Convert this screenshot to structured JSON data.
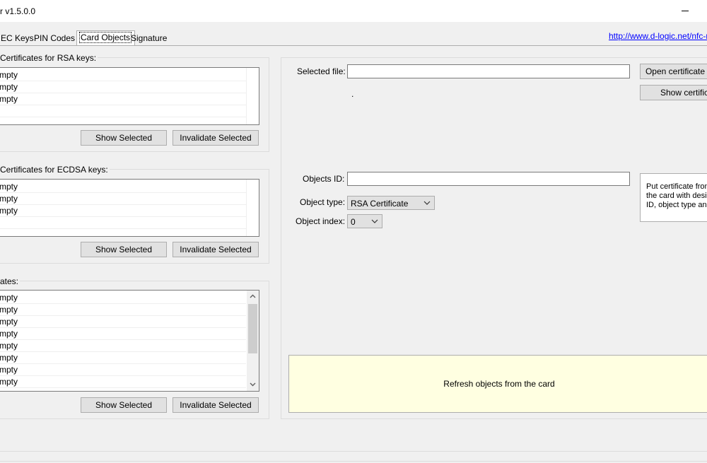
{
  "window": {
    "title": "r v1.5.0.0",
    "minimize_glyph": "minimize-icon"
  },
  "tabs": [
    {
      "label": "EC Keys"
    },
    {
      "label": "PIN Codes"
    },
    {
      "label": "Card Objects",
      "active": true
    },
    {
      "label": "Signature"
    }
  ],
  "link": "http://www.d-logic.net/nfc-rfi",
  "rsa_group": {
    "title": "Certificates for RSA keys:",
    "items": [
      "mpty",
      "mpty",
      "mpty"
    ],
    "show_label": "Show Selected",
    "invalidate_label": "Invalidate Selected"
  },
  "ecdsa_group": {
    "title": "Certificates for ECDSA keys:",
    "items": [
      "mpty",
      "mpty",
      "mpty"
    ],
    "show_label": "Show Selected",
    "invalidate_label": "Invalidate Selected"
  },
  "ca_group": {
    "title": "ates:",
    "items": [
      "mpty",
      "mpty",
      "mpty",
      "mpty",
      "mpty",
      "mpty",
      "mpty",
      "mpty"
    ],
    "show_label": "Show Selected",
    "invalidate_label": "Invalidate Selected"
  },
  "right_panel": {
    "selected_file_label": "Selected file:",
    "selected_file_value": "",
    "dot_text": ".",
    "open_cert_label": "Open certificate",
    "show_cert_label": "Show certifica",
    "objects_id_label": "Objects ID:",
    "objects_id_value": "",
    "object_type_label": "Object type:",
    "object_type_value": "RSA Certificate",
    "object_index_label": "Object index:",
    "object_index_value": "0",
    "info_lines": [
      "Put certificate from",
      "the card with desig",
      "ID, object type and"
    ],
    "refresh_label": "Refresh objects from the card"
  },
  "colors": {
    "link": "#0000ff",
    "refresh_bg": "#ffffe1"
  }
}
